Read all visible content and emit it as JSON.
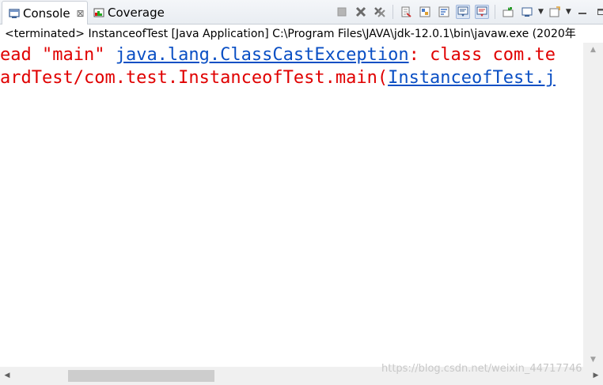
{
  "tabs": [
    {
      "label": "Console",
      "close": "⊠"
    },
    {
      "label": "Coverage"
    }
  ],
  "status": "<terminated> InstanceofTest [Java Application] C:\\Program Files\\JAVA\\jdk-12.0.1\\bin\\javaw.exe (2020年",
  "console": {
    "line1": {
      "pre": "ead \"main\" ",
      "link": "java.lang.ClassCastException",
      "post": ": class com.te"
    },
    "line2": {
      "pre": "ardTest/com.test.InstanceofTest.main(",
      "link": "InstanceofTest.j"
    }
  },
  "watermark": "https://blog.csdn.net/weixin_44717746",
  "colors": {
    "error_text": "#e00000",
    "link": "#0a4fc4"
  }
}
